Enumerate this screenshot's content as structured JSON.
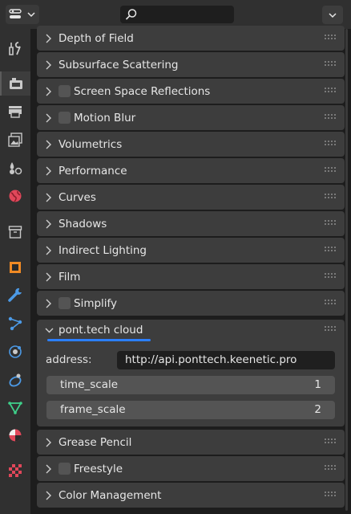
{
  "header": {
    "search_placeholder": "",
    "editor_type_icon": "properties-editor-icon",
    "search_icon": "search-icon"
  },
  "sidebar": {
    "tabs": [
      {
        "name": "tool",
        "icon": "wrench-screwdriver-icon",
        "color": "#c8c8c8"
      },
      {
        "name": "render",
        "icon": "camera-back-icon",
        "color": "#c8c8c8",
        "active": true
      },
      {
        "name": "output",
        "icon": "printer-icon",
        "color": "#c8c8c8"
      },
      {
        "name": "view-layer",
        "icon": "images-icon",
        "color": "#c8c8c8"
      },
      {
        "name": "scene",
        "icon": "scene-icon",
        "color": "#c8c8c8"
      },
      {
        "name": "world",
        "icon": "world-icon",
        "color": "#e0475a"
      },
      {
        "name": "collection",
        "icon": "box-icon",
        "color": "#c8c8c8"
      },
      {
        "name": "object",
        "icon": "object-cube-icon",
        "color": "#f08a24"
      },
      {
        "name": "modifiers",
        "icon": "wrench-icon",
        "color": "#4c9ae6"
      },
      {
        "name": "particles",
        "icon": "particles-icon",
        "color": "#4c9ae6"
      },
      {
        "name": "physics",
        "icon": "physics-orbit-icon",
        "color": "#4c9ae6"
      },
      {
        "name": "constraints",
        "icon": "constraint-icon",
        "color": "#4c9ae6"
      },
      {
        "name": "data",
        "icon": "mesh-data-icon",
        "color": "#3fd08a"
      },
      {
        "name": "material",
        "icon": "material-sphere-icon",
        "color": "#e0475a"
      },
      {
        "name": "texture",
        "icon": "checker-texture-icon",
        "color": "#e0475a"
      }
    ]
  },
  "panels": [
    {
      "label": "Depth of Field",
      "checkbox": false,
      "expanded": false
    },
    {
      "label": "Subsurface Scattering",
      "checkbox": false,
      "expanded": false
    },
    {
      "label": "Screen Space Reflections",
      "checkbox": true,
      "expanded": false
    },
    {
      "label": "Motion Blur",
      "checkbox": true,
      "expanded": false
    },
    {
      "label": "Volumetrics",
      "checkbox": false,
      "expanded": false
    },
    {
      "label": "Performance",
      "checkbox": false,
      "expanded": false
    },
    {
      "label": "Curves",
      "checkbox": false,
      "expanded": false
    },
    {
      "label": "Shadows",
      "checkbox": false,
      "expanded": false
    },
    {
      "label": "Indirect Lighting",
      "checkbox": false,
      "expanded": false
    },
    {
      "label": "Film",
      "checkbox": false,
      "expanded": false
    },
    {
      "label": "Simplify",
      "checkbox": true,
      "expanded": false
    },
    {
      "label": "pont.tech cloud",
      "checkbox": false,
      "expanded": true
    },
    {
      "label": "Grease Pencil",
      "checkbox": false,
      "expanded": false
    },
    {
      "label": "Freestyle",
      "checkbox": true,
      "expanded": false
    },
    {
      "label": "Color Management",
      "checkbox": false,
      "expanded": false
    }
  ],
  "pont_tech_cloud": {
    "address_label": "address:",
    "address_value": "http://api.ponttech.keenetic.pro",
    "time_scale_label": "time_scale",
    "time_scale_value": "1",
    "frame_scale_label": "frame_scale",
    "frame_scale_value": "2"
  },
  "colors": {
    "accent_underline": "#2b7fff",
    "panel_bg": "#3d3d3d",
    "background": "#1d1d1d"
  }
}
